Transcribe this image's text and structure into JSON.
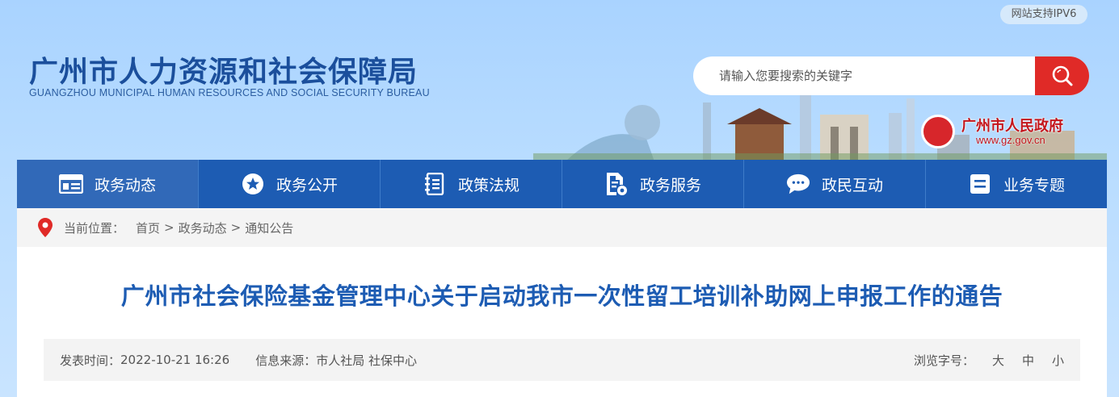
{
  "header": {
    "ipv6_badge": "网站支持IPV6",
    "logo_cn": "广州市人力资源和社会保障局",
    "logo_en": "GUANGZHOU MUNICIPAL HUMAN RESOURCES AND SOCIAL SECURITY BUREAU",
    "search": {
      "placeholder": "请输入您要搜索的关键字",
      "value": ""
    },
    "gov_link": {
      "name": "广州市人民政府",
      "url": "www.gz.gov.cn"
    }
  },
  "nav": {
    "items": [
      {
        "label": "政务动态",
        "icon": "list-icon",
        "active": true
      },
      {
        "label": "政务公开",
        "icon": "star-icon",
        "active": false
      },
      {
        "label": "政策法规",
        "icon": "notebook-icon",
        "active": false
      },
      {
        "label": "政务服务",
        "icon": "document-gear-icon",
        "active": false
      },
      {
        "label": "政民互动",
        "icon": "chat-icon",
        "active": false
      },
      {
        "label": "业务专题",
        "icon": "topic-icon",
        "active": false
      }
    ]
  },
  "breadcrumb": {
    "label": "当前位置：",
    "items": [
      "首页",
      "政务动态",
      "通知公告"
    ],
    "separator": ">"
  },
  "article": {
    "title": "广州市社会保险基金管理中心关于启动我市一次性留工培训补助网上申报工作的通告",
    "publish_label": "发表时间：",
    "publish_time": "2022-10-21 16:26",
    "source_label": "信息来源：",
    "source": "市人社局 社保中心",
    "fontsize_label": "浏览字号：",
    "fontsize_options": [
      "大",
      "中",
      "小"
    ]
  },
  "colors": {
    "nav_bg": "#1d5cb3",
    "nav_active": "#3169b8",
    "search_button": "#e02a27",
    "title": "#1d5cb3"
  }
}
